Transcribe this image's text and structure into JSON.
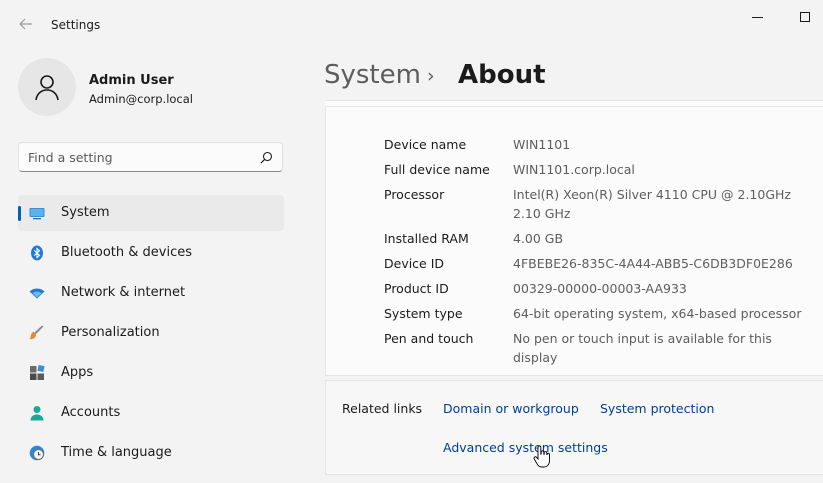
{
  "window": {
    "title": "Settings"
  },
  "user": {
    "name": "Admin User",
    "email": "Admin@corp.local"
  },
  "search": {
    "placeholder": "Find a setting"
  },
  "sidebar": {
    "items": [
      {
        "label": "System",
        "icon": "monitor-icon",
        "active": true
      },
      {
        "label": "Bluetooth & devices",
        "icon": "bluetooth-icon"
      },
      {
        "label": "Network & internet",
        "icon": "wifi-icon"
      },
      {
        "label": "Personalization",
        "icon": "brush-icon"
      },
      {
        "label": "Apps",
        "icon": "apps-icon"
      },
      {
        "label": "Accounts",
        "icon": "person-icon"
      },
      {
        "label": "Time & language",
        "icon": "clock-globe-icon"
      }
    ]
  },
  "breadcrumb": {
    "parent": "System",
    "separator": "›",
    "current": "About"
  },
  "specs": [
    {
      "label": "Device name",
      "value": "WIN1101"
    },
    {
      "label": "Full device name",
      "value": "WIN1101.corp.local"
    },
    {
      "label": "Processor",
      "value": "Intel(R) Xeon(R) Silver 4110 CPU @ 2.10GHz 2.10 GHz"
    },
    {
      "label": "Installed RAM",
      "value": "4.00 GB"
    },
    {
      "label": "Device ID",
      "value": "4FBEBE26-835C-4A44-ABB5-C6DB3DF0E286"
    },
    {
      "label": "Product ID",
      "value": "00329-00000-00003-AA933"
    },
    {
      "label": "System type",
      "value": "64-bit operating system, x64-based processor"
    },
    {
      "label": "Pen and touch",
      "value": "No pen or touch input is available for this display"
    }
  ],
  "related": {
    "label": "Related links",
    "domain": "Domain or workgroup",
    "protection": "System protection",
    "advanced": "Advanced system settings"
  },
  "colors": {
    "accent": "#005fb8",
    "link": "#003e92"
  }
}
